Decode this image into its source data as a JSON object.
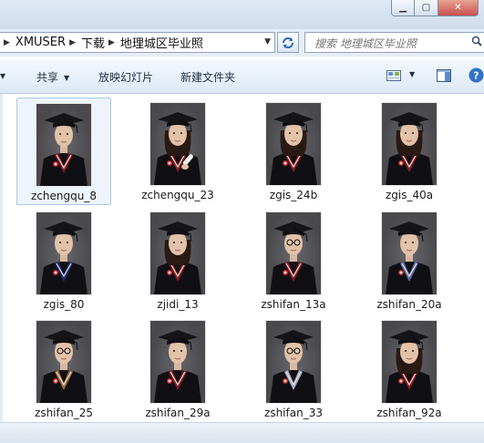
{
  "window": {
    "controls": {
      "minimize": "▁",
      "maximize": "▢",
      "close": "✕"
    }
  },
  "address": {
    "crumbs": [
      "XMUSER",
      "下载",
      "地理城区毕业照"
    ],
    "search_placeholder": "搜索 地理城区毕业照"
  },
  "commands": {
    "share": "共享",
    "slideshow": "放映幻灯片",
    "new_folder": "新建文件夹"
  },
  "files": [
    {
      "name": "zchengqu_8",
      "selected": true,
      "subject": "male",
      "gown_trim": "#8a1c22"
    },
    {
      "name": "zchengqu_23",
      "selected": false,
      "subject": "female-diploma",
      "gown_trim": "#8a1c22"
    },
    {
      "name": "zgis_24b",
      "selected": false,
      "subject": "female-long-hair",
      "gown_trim": "#8a1c22"
    },
    {
      "name": "zgis_40a",
      "selected": false,
      "subject": "female-long-hair",
      "gown_trim": "#8a1c22"
    },
    {
      "name": "zgis_80",
      "selected": false,
      "subject": "male",
      "gown_trim": "#1d2e78"
    },
    {
      "name": "zjidi_13",
      "selected": false,
      "subject": "female-long-hair",
      "gown_trim": "#8a1c22"
    },
    {
      "name": "zshifan_13a",
      "selected": false,
      "subject": "male-glasses",
      "gown_trim": "#8a1c22"
    },
    {
      "name": "zshifan_20a",
      "selected": false,
      "subject": "male",
      "gown_trim": "#5a6fa8"
    },
    {
      "name": "zshifan_25",
      "selected": false,
      "subject": "male-glasses",
      "gown_trim": "#a06a3a"
    },
    {
      "name": "zshifan_29a",
      "selected": false,
      "subject": "male",
      "gown_trim": "#8a1c22"
    },
    {
      "name": "zshifan_33",
      "selected": false,
      "subject": "male-glasses",
      "gown_trim": "#a7b0c8"
    },
    {
      "name": "zshifan_92a",
      "selected": false,
      "subject": "female-long-hair",
      "gown_trim": "#8a1c22"
    }
  ],
  "colors": {
    "accent": "#3a6ea5",
    "selection_fill": "#eef4fc",
    "selection_border": "#a9c8ec",
    "photo_background": "#4a4a4e",
    "gown": "#101014"
  }
}
